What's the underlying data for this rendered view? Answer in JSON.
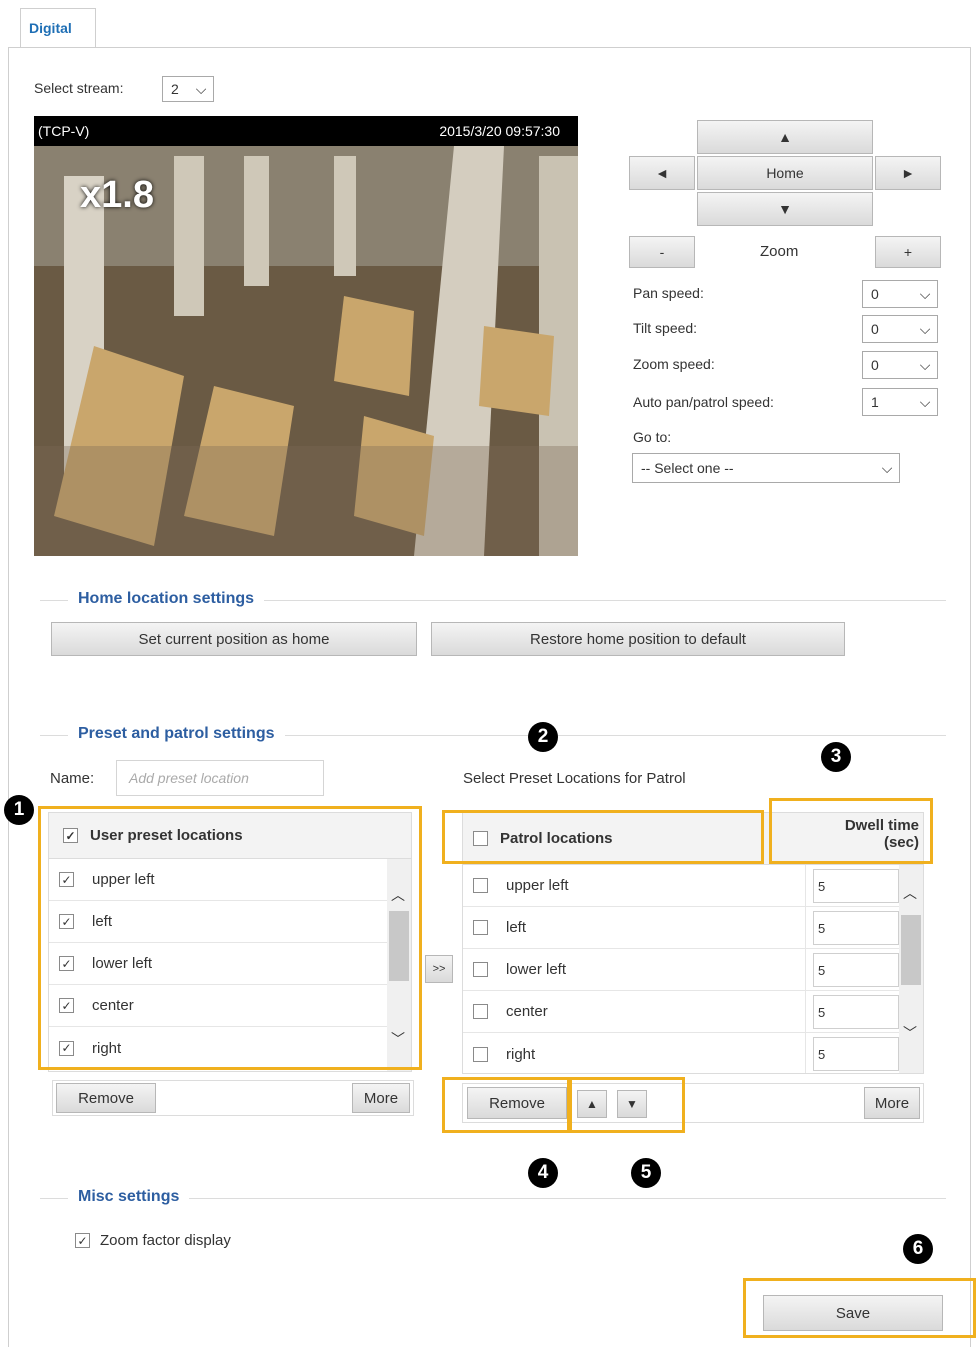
{
  "tab": {
    "label": "Digital"
  },
  "stream": {
    "label": "Select stream:",
    "value": "2"
  },
  "video": {
    "protocol": "(TCP-V)",
    "timestamp": "2015/3/20 09:57:30",
    "zoom_factor": "x1.8"
  },
  "ptz": {
    "up": "▲",
    "down": "▼",
    "left": "◄",
    "right": "►",
    "home": "Home",
    "zoom_out": "-",
    "zoom_label": "Zoom",
    "zoom_in": "+"
  },
  "speeds": {
    "pan_label": "Pan speed:",
    "pan_value": "0",
    "tilt_label": "Tilt speed:",
    "tilt_value": "0",
    "zoom_label": "Zoom speed:",
    "zoom_value": "0",
    "auto_label": "Auto pan/patrol speed:",
    "auto_value": "1",
    "goto_label": "Go to:",
    "goto_value": "-- Select one --"
  },
  "home_section": {
    "title": "Home location settings",
    "set_button": "Set current position as home",
    "restore_button": "Restore home position to default"
  },
  "preset_section": {
    "title": "Preset and patrol settings",
    "name_label": "Name:",
    "name_placeholder": "Add preset location",
    "patrol_caption": "Select Preset Locations for Patrol",
    "user_header": "User preset locations",
    "user_items": [
      "upper left",
      "left",
      "lower left",
      "center",
      "right"
    ],
    "patrol_header": "Patrol locations",
    "dwell_header_1": "Dwell time",
    "dwell_header_2": "(sec)",
    "patrol_items": [
      "upper left",
      "left",
      "lower left",
      "center",
      "right"
    ],
    "dwell_values": [
      "5",
      "5",
      "5",
      "5",
      "5"
    ],
    "add_button": ">>",
    "remove_left": "Remove",
    "more_left": "More",
    "remove_right": "Remove",
    "move_up": "▲",
    "move_down": "▼",
    "more_right": "More"
  },
  "misc_section": {
    "title": "Misc settings",
    "zoom_factor_label": "Zoom factor display"
  },
  "save_button": "Save",
  "callouts": [
    "1",
    "2",
    "3",
    "4",
    "5",
    "6"
  ],
  "colors": {
    "accent": "#2d5ea1",
    "highlight": "#f0b01e",
    "tab_text": "#1f6fb5"
  }
}
